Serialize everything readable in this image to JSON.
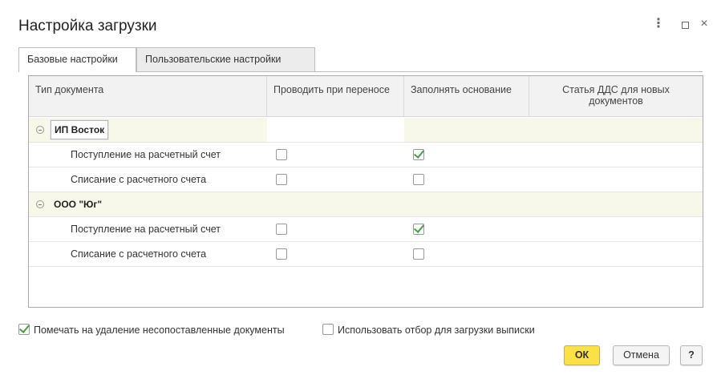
{
  "window": {
    "title": "Настройка загрузки",
    "more_glyph": "⋮",
    "close_glyph": "×"
  },
  "tabs": [
    {
      "label": "Базовые настройки",
      "active": true
    },
    {
      "label": "Пользовательские настройки",
      "active": false
    }
  ],
  "grid": {
    "columns": [
      "Тип документа",
      "Проводить при переносе",
      "Заполнять основание",
      "Статья ДДС для новых документов"
    ],
    "groups": [
      {
        "name": "ИП Восток",
        "rows": [
          {
            "doc": "Поступление на расчетный счет",
            "post": false,
            "fill_basis": true,
            "dds_item": ""
          },
          {
            "doc": "Списание с расчетного счета",
            "post": false,
            "fill_basis": false,
            "dds_item": ""
          }
        ]
      },
      {
        "name": "ООО \"Юг\"",
        "rows": [
          {
            "doc": "Поступление на расчетный счет",
            "post": false,
            "fill_basis": true,
            "dds_item": ""
          },
          {
            "doc": "Списание с расчетного счета",
            "post": false,
            "fill_basis": false,
            "dds_item": ""
          }
        ]
      }
    ]
  },
  "options": {
    "mark_delete_label": "Помечать на удаление несопоставленные документы",
    "mark_delete_checked": true,
    "use_filter_label": "Использовать отбор для загрузки выписки",
    "use_filter_checked": false
  },
  "buttons": {
    "ok": "ОК",
    "cancel": "Отмена",
    "help": "?"
  },
  "colors": {
    "ok_button": "#fbe145",
    "check_mark": "#3aa53a",
    "group_row": "#f7f8e9"
  }
}
